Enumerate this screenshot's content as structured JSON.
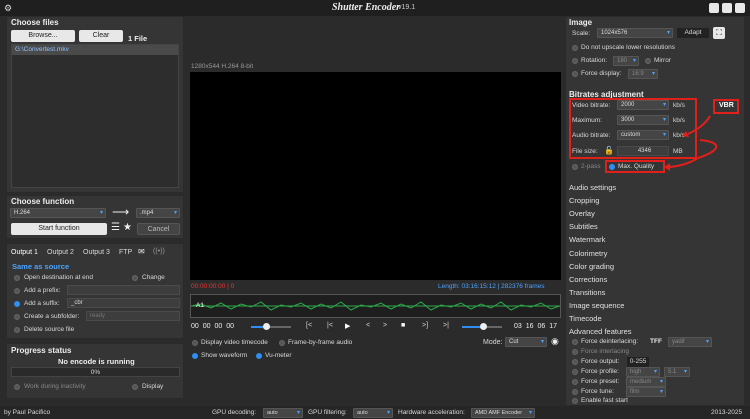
{
  "title": "Shutter Encoder",
  "version": "v19.1",
  "left": {
    "choose_files": "Choose files",
    "browse": "Browse...",
    "clear": "Clear",
    "file_count": "1 File",
    "files": [
      "G:\\Convertest.mkv"
    ],
    "choose_function": "Choose function",
    "function": "H.264",
    "container": ".mp4",
    "start": "Start function",
    "cancel": "Cancel",
    "tabs": [
      "Output 1",
      "Output 2",
      "Output 3",
      "FTP"
    ],
    "same_as_source": "Same as source",
    "open_dest": "Open destination at end",
    "change": "Change",
    "add_prefix": "Add a prefix:",
    "add_suffix": "Add a suffix:",
    "suffix_value": "_cbr",
    "create_subfolder": "Create a subfolder:",
    "subfolder_placeholder": "ready",
    "delete_source": "Delete source file",
    "progress_status": "Progress status",
    "no_encode": "No encode is running",
    "percent": "0%",
    "work_inactivity": "Work during inactivity",
    "display": "Display"
  },
  "center": {
    "media_info": "1280x544 H.264 8-bit",
    "time_current": "00:00:00:00 | 0",
    "length": "Length: 03:16:15:12 | 282376 frames",
    "track": "A1",
    "tc_in": [
      "00",
      "00",
      "00",
      "00"
    ],
    "tc_out": [
      "03",
      "16",
      "06",
      "17"
    ],
    "transport": [
      "|<",
      "<",
      "▶",
      ">",
      "■",
      ">]",
      ">|"
    ],
    "transport_first": "[<",
    "display_tc": "Display video timecode",
    "frame_audio": "Frame-by-frame audio",
    "show_waveform": "Show waveform",
    "vumeter": "Vu-meter",
    "mode_label": "Mode:",
    "mode": "Cut"
  },
  "right": {
    "image": "Image",
    "scale_label": "Scale:",
    "scale": "1024x576",
    "adapt": "Adapt",
    "no_upscale": "Do not upscale lower resolutions",
    "rotation": "Rotation:",
    "rotation_val": "180",
    "mirror": "Mirror",
    "force_display": "Force display:",
    "force_display_val": "16:9",
    "bitrates": "Bitrates adjustment",
    "video_bitrate": "Video bitrate:",
    "video_bitrate_val": "2000",
    "kbs": "kb/s",
    "maximum": "Maximum:",
    "maximum_val": "3000",
    "audio_bitrate": "Audio bitrate:",
    "audio_bitrate_val": "custom",
    "file_size": "File size:",
    "file_size_val": "4346",
    "mb": "MB",
    "two_pass": "2-pass",
    "max_quality": "Max. Quality",
    "vbr": "VBR",
    "sections": [
      "Audio settings",
      "Cropping",
      "Overlay",
      "Subtitles",
      "Watermark",
      "Colorimetry",
      "Color grading",
      "Corrections",
      "Transitions",
      "Image sequence",
      "Timecode"
    ],
    "advanced": "Advanced features",
    "force_deinterlacing": "Force deinterlacing:",
    "tff": "TFF",
    "yadif": "yadif",
    "force_interlacing": "Force interlacing",
    "force_output": "Force output:",
    "force_output_val": "0-255",
    "force_profile": "Force profile:",
    "profile_val": "high",
    "level_val": "5.1",
    "force_preset": "Force preset:",
    "preset_val": "medium",
    "force_tune": "Force tune:",
    "tune_val": "film",
    "fast_start": "Enable fast start"
  },
  "footer": {
    "by": "by Paul Pacifico",
    "gpu_decoding": "GPU decoding:",
    "gpu_decoding_val": "auto",
    "gpu_filtering": "GPU filtering:",
    "gpu_filtering_val": "auto",
    "hw_accel": "Hardware acceleration:",
    "hw_accel_val": "AMD AMF Encoder",
    "years": "2013-2025"
  },
  "colors": {
    "accent": "#2f8ef0",
    "annotation": "#e0201a",
    "waveform": "#2fa84a"
  }
}
